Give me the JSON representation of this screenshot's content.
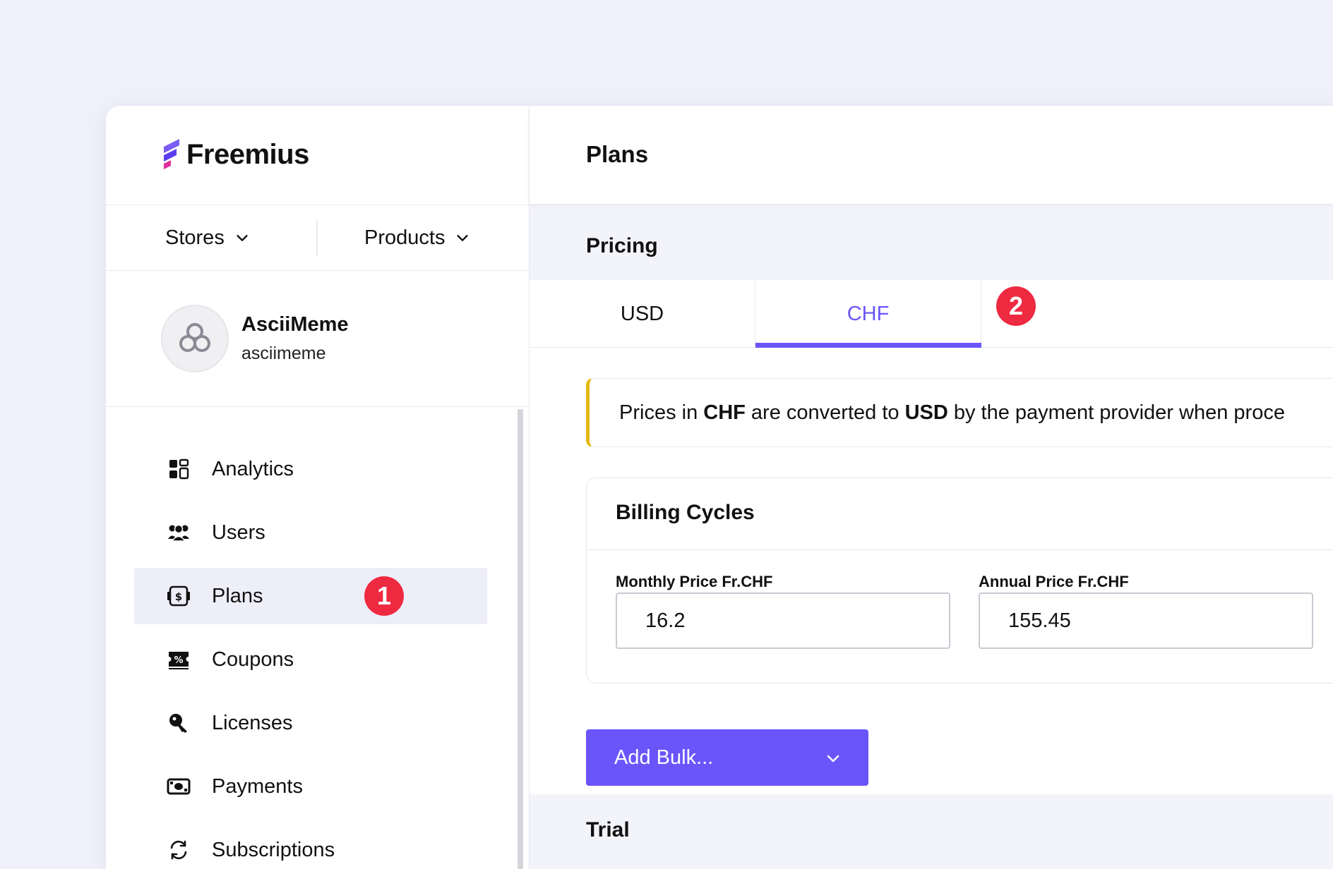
{
  "brand": {
    "name": "Freemius",
    "accent": "#6a55fa",
    "badge_color": "#ee2a41",
    "warning": "#e4b80f"
  },
  "switchers": {
    "stores": "Stores",
    "products": "Products"
  },
  "store": {
    "name": "AsciiMeme",
    "slug": "asciimeme"
  },
  "nav": {
    "items": [
      {
        "label": "Analytics",
        "icon": "analytics-icon"
      },
      {
        "label": "Users",
        "icon": "users-icon"
      },
      {
        "label": "Plans",
        "icon": "plans-icon",
        "active": true,
        "badge": "1"
      },
      {
        "label": "Coupons",
        "icon": "coupons-icon"
      },
      {
        "label": "Licenses",
        "icon": "licenses-icon"
      },
      {
        "label": "Payments",
        "icon": "payments-icon"
      },
      {
        "label": "Subscriptions",
        "icon": "subscriptions-icon"
      }
    ]
  },
  "header": {
    "title": "Plans"
  },
  "pricing": {
    "title": "Pricing",
    "tabs": [
      {
        "label": "USD"
      },
      {
        "label": "CHF",
        "active": true
      }
    ],
    "tab_badge": "2",
    "notice": {
      "prefix": "Prices in ",
      "currency_from": "CHF",
      "middle": " are converted to ",
      "currency_to": "USD",
      "suffix": " by the payment provider when proce"
    },
    "billing": {
      "title": "Billing Cycles",
      "monthly_label": "Monthly Price Fr.CHF",
      "monthly_value": "16.2",
      "annual_label": "Annual Price Fr.CHF",
      "annual_value": "155.45"
    },
    "add_bulk_label": "Add Bulk..."
  },
  "trial": {
    "title": "Trial"
  }
}
